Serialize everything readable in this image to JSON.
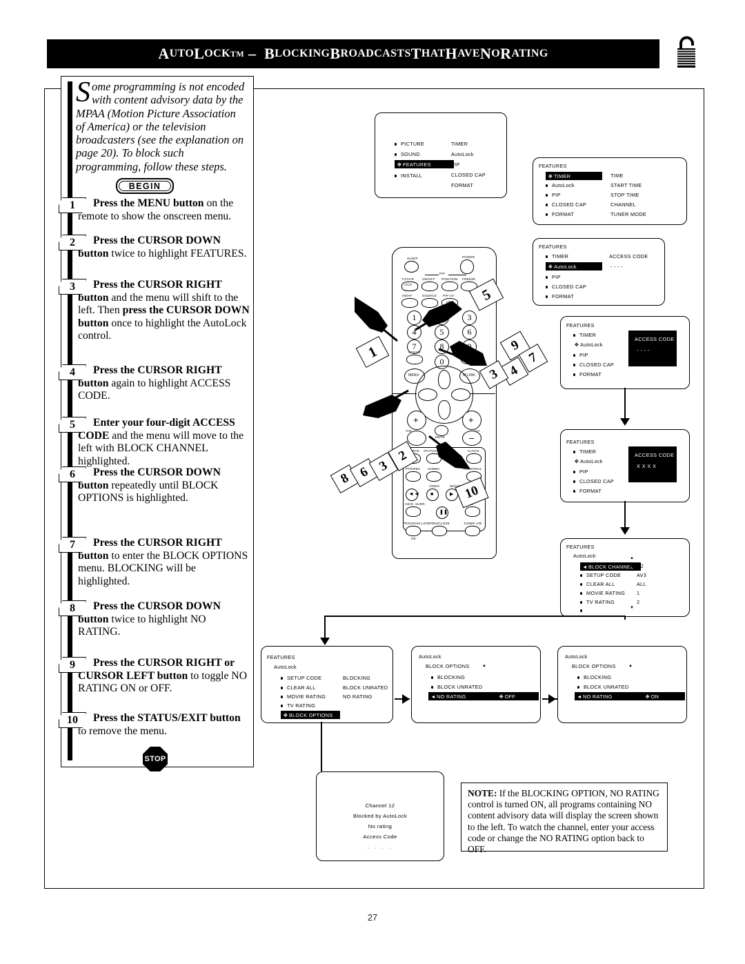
{
  "header": {
    "title_main": "UTO",
    "title": "AUTOLOCK™ – BLOCKING BROADCASTS THAT HAVE NO RATING",
    "lock_icon": "padlock-open-icon"
  },
  "intro": {
    "dropcap": "S",
    "text": "ome programming is not encoded with content advisory data by the MPAA (Motion Picture Association of America) or the television broadcasters (see the explanation on page 20). To block such programming, follow these steps."
  },
  "badges": {
    "begin": "BEGIN",
    "stop": "STOP"
  },
  "steps": [
    {
      "num": "1",
      "html": "<b>Press the MENU button</b> on the remote to show the onscreen menu."
    },
    {
      "num": "2",
      "html": "<b>Press the CURSOR DOWN button</b> twice to highlight FEATURES."
    },
    {
      "num": "3",
      "html": "<b>Press the CURSOR RIGHT button</b> and the menu will shift to the left. Then <b>press the CURSOR DOWN button</b> once to highlight the AutoLock control."
    },
    {
      "num": "4",
      "html": "<b>Press the CURSOR RIGHT button</b> again to highlight ACCESS CODE."
    },
    {
      "num": "5",
      "html": "<b>Enter your four-digit ACCESS CODE</b> and the menu will move to the left with BLOCK CHANNEL highlighted."
    },
    {
      "num": "6",
      "html": "<b>Press the CURSOR DOWN button</b> repeatedly until BLOCK OPTIONS is highlighted."
    },
    {
      "num": "7",
      "html": "<b>Press the CURSOR RIGHT button</b> to enter the BLOCK OPTIONS menu. BLOCKING will be highlighted."
    },
    {
      "num": "8",
      "html": "<b>Press the CURSOR DOWN button</b> twice to highlight NO RATING."
    },
    {
      "num": "9",
      "html": "<b>Press the CURSOR RIGHT or CURSOR LEFT button</b> to toggle NO RATING ON or OFF."
    },
    {
      "num": "10",
      "html": "<b>Press the STATUS/EXIT button</b> to remove the menu."
    }
  ],
  "screens": {
    "main_menu": {
      "left_items": [
        "PICTURE",
        "SOUND",
        "FEATURES",
        "INSTALL"
      ],
      "highlight": "FEATURES",
      "right_items": [
        "TIMER",
        "AutoLock",
        "PIP",
        "CLOSED CAP",
        "FORMAT"
      ]
    },
    "features_timer": {
      "header": "FEATURES",
      "left_items": [
        "TIMER",
        "AutoLock",
        "PIP",
        "CLOSED CAP",
        "FORMAT"
      ],
      "highlight": "TIMER",
      "right_items": [
        "TIME",
        "START TIME",
        "STOP TIME",
        "CHANNEL",
        "TUNER MODE"
      ]
    },
    "features_autolock": {
      "header": "FEATURES",
      "left_items": [
        "TIMER",
        "AutoLock",
        "PIP",
        "CLOSED CAP",
        "FORMAT"
      ],
      "highlight": "AutoLock",
      "right_items": [
        "ACCESS CODE",
        "- - - -"
      ]
    },
    "access_code_empty": {
      "header": "FEATURES",
      "left_items": [
        "TIMER",
        "AutoLock",
        "PIP",
        "CLOSED CAP",
        "FORMAT"
      ],
      "cursor_on": "AutoLock",
      "box_title": "ACCESS CODE",
      "box_value": "- - - -"
    },
    "access_code_entered": {
      "header": "FEATURES",
      "left_items": [
        "TIMER",
        "AutoLock",
        "PIP",
        "CLOSED CAP",
        "FORMAT"
      ],
      "cursor_on": "AutoLock",
      "box_title": "ACCESS CODE",
      "box_value": "X X X X"
    },
    "block_channel": {
      "header": "FEATURES",
      "subheader": "AutoLock",
      "left_items": [
        "BLOCK CHANNEL",
        "SETUP CODE",
        "CLEAR ALL",
        "MOVIE RATING",
        "TV RATING",
        ""
      ],
      "highlight": "BLOCK CHANNEL",
      "right_items": [
        "AV2",
        "AV3",
        "ALL",
        "1",
        "2"
      ],
      "scroll_up": "▲",
      "scroll_down": "▼"
    },
    "block_options_select": {
      "header": "FEATURES",
      "subheader": "AutoLock",
      "left_items": [
        "SETUP CODE",
        "CLEAR ALL",
        "MOVIE RATING",
        "TV RATING",
        "BLOCK OPTIONS"
      ],
      "highlight": "BLOCK OPTIONS",
      "right_items": [
        "BLOCKING",
        "BLOCK UNRATED",
        "NO RATING"
      ]
    },
    "no_rating_off": {
      "header": "AutoLock",
      "subheader": "BLOCK OPTIONS",
      "items": [
        "BLOCKING",
        "BLOCK UNRATED",
        "NO RATING"
      ],
      "highlight": "NO RATING",
      "value": "OFF",
      "scroll_up": "▲"
    },
    "no_rating_on": {
      "header": "AutoLock",
      "subheader": "BLOCK OPTIONS",
      "items": [
        "BLOCKING",
        "BLOCK UNRATED",
        "NO RATING"
      ],
      "highlight": "NO RATING",
      "value": "ON",
      "scroll_up": "▲"
    },
    "blocked_screen": {
      "line1": "Channel  12",
      "line2": "Blocked by AutoLock",
      "line3": "No  rating",
      "line4": "Access Code",
      "line5": "· · · ·"
    }
  },
  "remote": {
    "labels": {
      "sleep": "SLEEP",
      "power": "POWER",
      "pip": "PIP",
      "tvvcr": "TV/VCR",
      "ach": "A/CH",
      "onoff": "ON/OFF",
      "position": "POSITION",
      "freeze": "FREEZE",
      "swap": "SWAP",
      "source": "SOURCE",
      "pipch": "PIP CH",
      "up": "UP",
      "sound": "SOUND",
      "picture": "PICTURE",
      "menu": "MENU",
      "mlink": "M LINK",
      "vol": "VOL",
      "ch": "CH",
      "mute": "MUTE",
      "src2": "SOURCE",
      "statusexit": "STATUS/EXIT",
      "cc": "CC",
      "clock": "CLOCK",
      "ptrrec": "PTR/REC",
      "hobbs": "HOBBS",
      "personal": "PERSONAL",
      "video": "VIDEO",
      "movies": "MOVIES",
      "incrsurr": "INCR. SURR.",
      "surf": "SURF",
      "programlist": "PROGRAM LIST",
      "openclose": "OPEN/CLOSE",
      "tunerab": "TUNER A/B",
      "ok": "OK"
    },
    "keypad": [
      "1",
      "2",
      "3",
      "4",
      "5",
      "6",
      "7",
      "8",
      "9",
      "0"
    ]
  },
  "callouts": {
    "left": "1",
    "upper_right": "5",
    "right_group": [
      "9",
      "7",
      "4",
      "3"
    ],
    "lower_left_group": [
      "8",
      "6",
      "3",
      "2"
    ],
    "lower_right": "10"
  },
  "note": {
    "label": "NOTE:",
    "text": " If the BLOCKING OPTION, NO RATING control is turned ON, all programs containing NO content advisory data will display the screen shown to the left. To watch the channel, enter your access code or change the NO RATING option back to OFF."
  },
  "page_number": "27"
}
